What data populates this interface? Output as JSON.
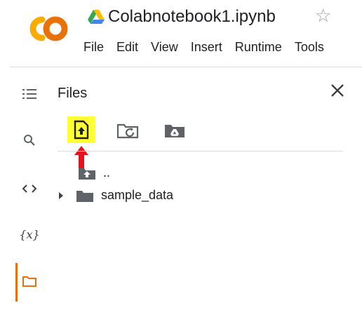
{
  "app": {
    "title": "Colabnotebook1.ipynb"
  },
  "menu": {
    "items": [
      "File",
      "Edit",
      "View",
      "Insert",
      "Runtime",
      "Tools"
    ]
  },
  "sidebar": {
    "icons": [
      "toc-icon",
      "search-icon",
      "code-icon",
      "variables-icon",
      "folder-icon"
    ],
    "variables_label": "{x}",
    "active_color": "#e8710a"
  },
  "files_panel": {
    "title": "Files",
    "rows": [
      {
        "label": "..",
        "type": "parent"
      },
      {
        "label": "sample_data",
        "type": "folder"
      }
    ]
  },
  "colors": {
    "logo_orange": "#f9ab00",
    "logo_dark_orange": "#e8710a",
    "highlight": "#ffff33",
    "arrow_red": "#e8121c",
    "icon_gray": "#5f6368"
  }
}
